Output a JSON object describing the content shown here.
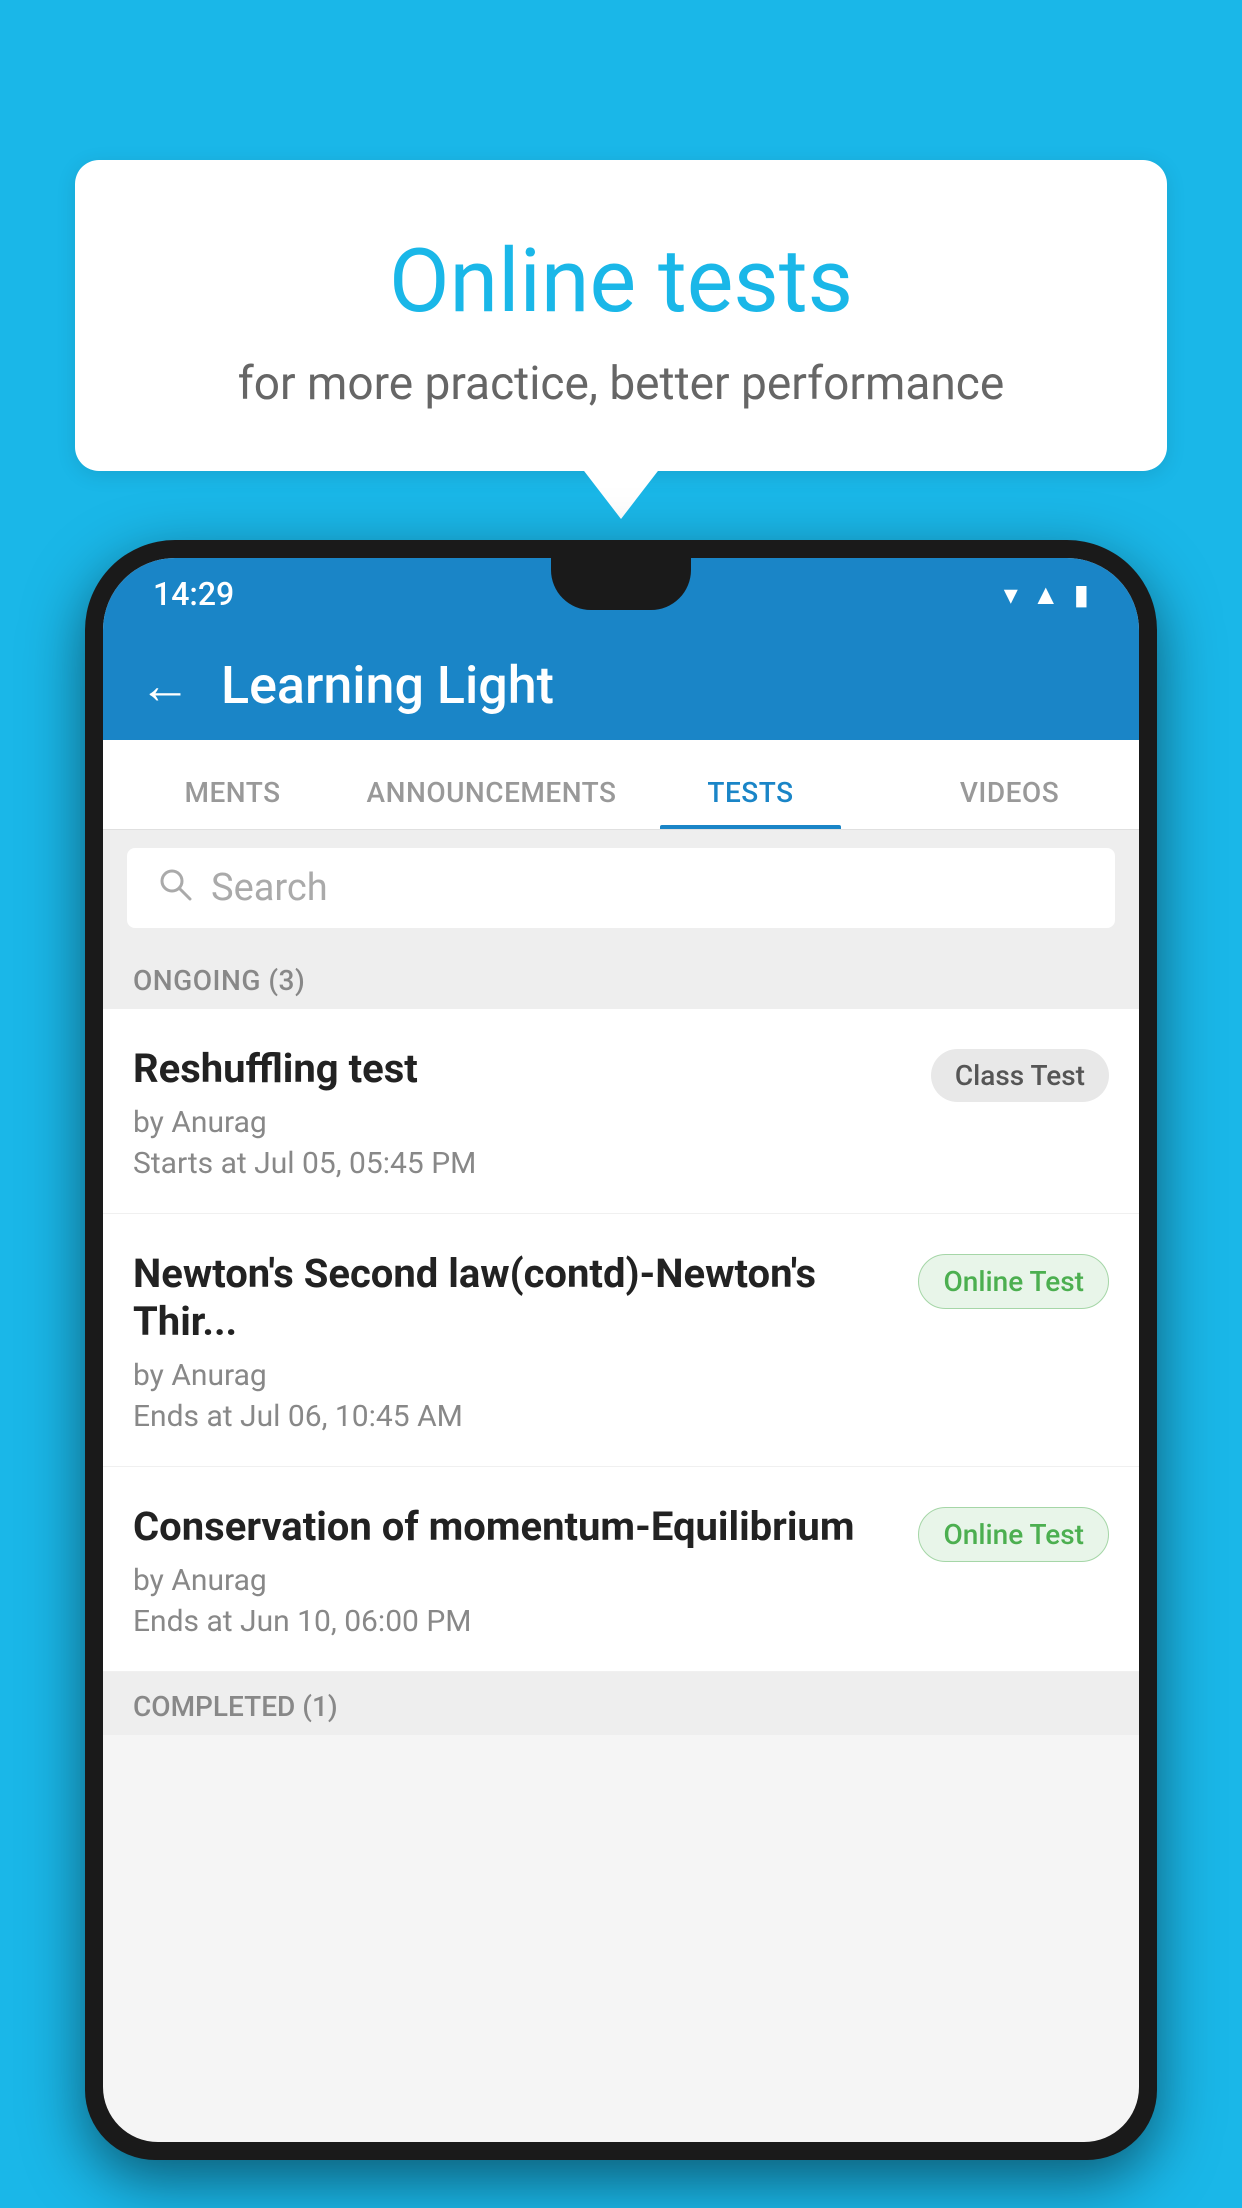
{
  "background_color": "#1ab7e8",
  "speech_bubble": {
    "title": "Online tests",
    "subtitle": "for more practice, better performance"
  },
  "phone": {
    "status_bar": {
      "time": "14:29",
      "icons": [
        "wifi",
        "signal",
        "battery"
      ]
    },
    "app_header": {
      "title": "Learning Light",
      "back_label": "←"
    },
    "tabs": [
      {
        "label": "MENTS",
        "active": false
      },
      {
        "label": "ANNOUNCEMENTS",
        "active": false
      },
      {
        "label": "TESTS",
        "active": true
      },
      {
        "label": "VIDEOS",
        "active": false
      }
    ],
    "search": {
      "placeholder": "Search"
    },
    "sections": [
      {
        "header": "ONGOING (3)",
        "items": [
          {
            "name": "Reshuffling test",
            "by": "by Anurag",
            "date": "Starts at  Jul 05, 05:45 PM",
            "badge": "Class Test",
            "badge_type": "class"
          },
          {
            "name": "Newton's Second law(contd)-Newton's Thir...",
            "by": "by Anurag",
            "date": "Ends at  Jul 06, 10:45 AM",
            "badge": "Online Test",
            "badge_type": "online"
          },
          {
            "name": "Conservation of momentum-Equilibrium",
            "by": "by Anurag",
            "date": "Ends at  Jun 10, 06:00 PM",
            "badge": "Online Test",
            "badge_type": "online"
          }
        ]
      },
      {
        "header": "COMPLETED (1)",
        "items": []
      }
    ]
  }
}
